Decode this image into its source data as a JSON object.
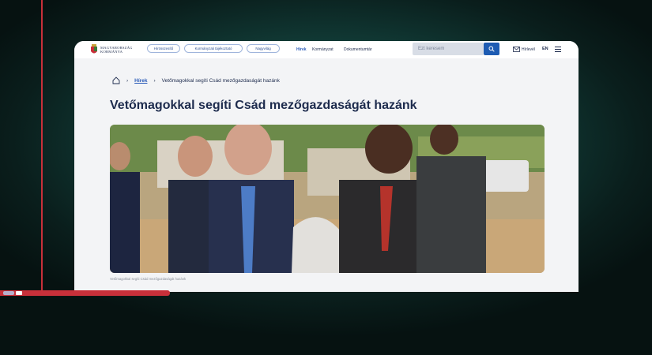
{
  "header": {
    "logo_line1": "MAGYARORSZÁG",
    "logo_line2": "KORMÁNYA",
    "pills": [
      "Hírösszesítő",
      "Kormányzati tájékoztató",
      "Nagyvilág"
    ],
    "nav_links": [
      "Hírek",
      "Kormányzat",
      "Dokumentumtár"
    ],
    "active_nav": "Hírek",
    "search_placeholder": "Ezt keresem",
    "newsletter_label": "Hírlevél",
    "lang_label": "EN"
  },
  "breadcrumb": {
    "home_icon": "home-icon",
    "items": [
      "Hírek",
      "Vetőmagokkal segíti Csád mezőgazdaságát hazánk"
    ]
  },
  "article": {
    "title": "Vetőmagokkal segíti Csád mezőgazdaságát hazánk",
    "caption": "Vetőmagokkal segíti Csád mezőgazdaságát hazánk"
  },
  "video": {
    "progress_fraction": 0.26
  },
  "colors": {
    "accent": "#1e5cb3",
    "progress": "#c8303a",
    "title": "#1d2b4d"
  }
}
